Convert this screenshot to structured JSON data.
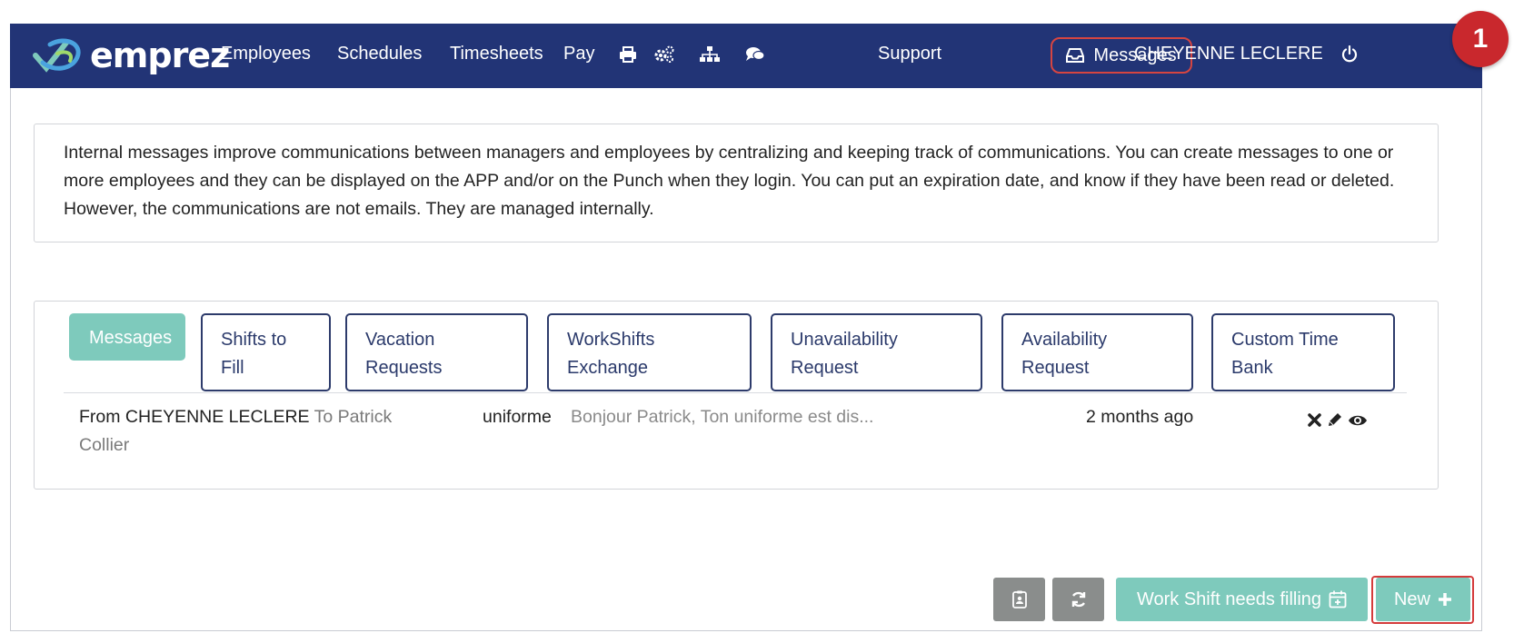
{
  "brand": {
    "name": "emprez"
  },
  "nav": {
    "links": [
      "Employees",
      "Schedules",
      "Timesheets",
      "Pay"
    ],
    "icons": [
      "print-icon",
      "cogs-icon",
      "sitemap-icon",
      "comments-icon"
    ],
    "support": "Support",
    "messages": "Messages",
    "user": "CHEYENNE LECLERE"
  },
  "badge": "1",
  "info": {
    "text": "Internal messages improve communications between managers and employees by centralizing and keeping track of communications. You can create messages to one or more employees and they can be displayed on the APP and/or on the Punch when they login. You can put an expiration date, and know if they have been read or deleted. However, the communications are not emails. They are managed internally."
  },
  "tabs": [
    {
      "label": "Messages",
      "active": true
    },
    {
      "label": "Shifts to Fill",
      "active": false
    },
    {
      "label": "Vacation Requests",
      "active": false
    },
    {
      "label": "WorkShifts Exchange",
      "active": false
    },
    {
      "label": "Unavailability Request",
      "active": false
    },
    {
      "label": "Availability Request",
      "active": false
    },
    {
      "label": "Custom Time Bank",
      "active": false
    }
  ],
  "messages": [
    {
      "from": "From CHEYENNE LECLERE",
      "to": "To Patrick Collier",
      "subject": "uniforme",
      "preview": "Bonjour Patrick, Ton uniforme est dis...",
      "time": "2 months ago"
    }
  ],
  "bottom": {
    "work_shift": "Work Shift needs filling",
    "new": "New"
  },
  "colors": {
    "navbar": "#223476",
    "accent": "#7ecabc",
    "danger": "#c9282d"
  }
}
